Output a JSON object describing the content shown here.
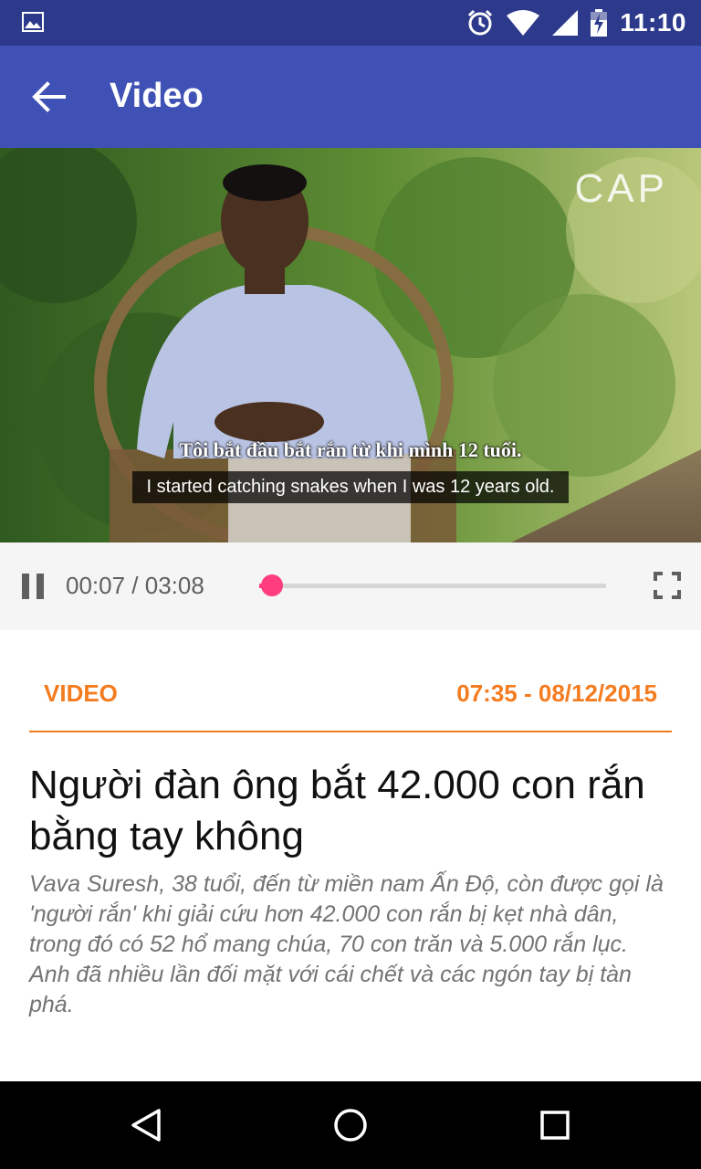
{
  "status_bar": {
    "time": "11:10",
    "icons": [
      "image-icon",
      "alarm-icon",
      "wifi-icon",
      "signal-icon",
      "battery-icon"
    ]
  },
  "app_bar": {
    "title": "Video",
    "back_icon": "arrow-back-icon"
  },
  "video": {
    "subtitle_vi": "Tôi bắt đầu bắt rắn từ khi mình 12 tuổi.",
    "subtitle_en": "I started catching snakes when I was 12 years old.",
    "watermark": "CAP"
  },
  "player": {
    "time_display": "00:07 / 03:08",
    "progress_fraction": 0.037,
    "pause_icon": "pause-icon",
    "fullscreen_icon": "fullscreen-icon",
    "accent_color": "#ff3d7f"
  },
  "article": {
    "category": "VIDEO",
    "datetime": "07:35 - 08/12/2015",
    "headline": "Người đàn ông bắt 42.000 con rắn bằng tay không",
    "summary": "Vava Suresh, 38 tuổi, đến từ miền nam Ấn Độ, còn được gọi là 'người rắn' khi giải cứu hơn 42.000 con rắn bị kẹt nhà dân,  trong đó có 52 hổ mang chúa, 70 con trăn và 5.000 rắn lục. Anh đã nhiều lần đối mặt với cái chết và các ngón tay bị tàn phá.",
    "accent_color": "#f47c20"
  },
  "nav_bar": {
    "icons": [
      "back-triangle-icon",
      "home-circle-icon",
      "recents-square-icon"
    ]
  }
}
